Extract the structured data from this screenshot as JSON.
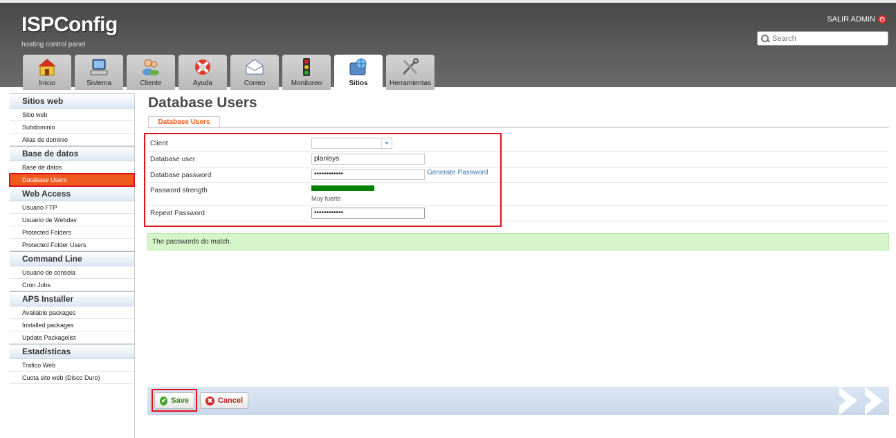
{
  "header": {
    "logo": "ISPConfig",
    "tagline": "hosting control panel",
    "logout_label": "SALIR ADMIN",
    "search_placeholder": "Search"
  },
  "tabs": [
    {
      "label": "Inicio",
      "icon": "home-icon"
    },
    {
      "label": "Sistema",
      "icon": "computer-icon"
    },
    {
      "label": "Cliente",
      "icon": "users-icon"
    },
    {
      "label": "Ayuda",
      "icon": "lifebuoy-icon"
    },
    {
      "label": "Correo",
      "icon": "envelope-icon"
    },
    {
      "label": "Monitoreo",
      "icon": "traffic-light-icon"
    },
    {
      "label": "Sitios",
      "icon": "globe-folder-icon",
      "active": true
    },
    {
      "label": "Herramientas",
      "icon": "tools-icon"
    }
  ],
  "sidebar": {
    "groups": [
      {
        "title": "Sitios web",
        "items": [
          "Sitio web",
          "Subdominio",
          "Alias de dominio"
        ]
      },
      {
        "title": "Base de datos",
        "items": [
          "Base de datos",
          "Database Users"
        ]
      },
      {
        "title": "Web Access",
        "items": [
          "Usuario FTP",
          "Usuario de Webdav",
          "Protected Folders",
          "Protected Folder Users"
        ]
      },
      {
        "title": "Command Line",
        "items": [
          "Usuario de consola",
          "Cron Jobs"
        ]
      },
      {
        "title": "APS Installer",
        "items": [
          "Available packages",
          "Installed packages",
          "Update Packagelist"
        ]
      },
      {
        "title": "Estadísticas",
        "items": [
          "Trafico Web",
          "Cuota sito web (Disco Duro)"
        ]
      }
    ],
    "active_item": "Database Users"
  },
  "main": {
    "title": "Database Users",
    "form_tab": "Database Users",
    "fields": {
      "client_label": "Client",
      "client_value": "",
      "user_label": "Database user",
      "user_value": "planisys",
      "password_label": "Database password",
      "password_value": "••••••••••••",
      "generate_password": "Generate Password",
      "strength_label": "Password strength",
      "strength_text": "Muy fuerte",
      "strength_level": 1.0,
      "repeat_label": "Repeat Password",
      "repeat_value": "••••••••••••"
    },
    "match_message": "The passwords do match.",
    "save_label": "Save",
    "cancel_label": "Cancel"
  },
  "colors": {
    "accent": "#ef5b1f",
    "highlight": "#e2101a",
    "strength": "#008000",
    "success_bg": "#d6f5c8",
    "link": "#3a6fae"
  }
}
